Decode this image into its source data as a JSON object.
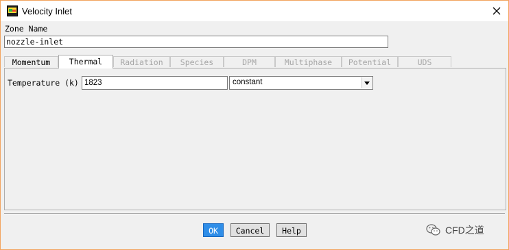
{
  "window": {
    "title": "Velocity Inlet"
  },
  "zone": {
    "label": "Zone Name",
    "value": "nozzle-inlet"
  },
  "tabs": [
    {
      "label": "Momentum",
      "state": "enabled"
    },
    {
      "label": "Thermal",
      "state": "active"
    },
    {
      "label": "Radiation",
      "state": "disabled"
    },
    {
      "label": "Species",
      "state": "disabled"
    },
    {
      "label": "DPM",
      "state": "disabled"
    },
    {
      "label": "Multiphase",
      "state": "disabled"
    },
    {
      "label": "Potential",
      "state": "disabled"
    },
    {
      "label": "UDS",
      "state": "disabled"
    }
  ],
  "thermal": {
    "temperature_label": "Temperature (k)",
    "temperature_value": "1823",
    "method_value": "constant"
  },
  "buttons": {
    "ok": "OK",
    "cancel": "Cancel",
    "help": "Help"
  },
  "watermark": {
    "text": "CFD之道",
    "icon": "wechat-icon"
  },
  "colors": {
    "accent": "#2f8ee8",
    "window_border": "#f2a35d"
  }
}
